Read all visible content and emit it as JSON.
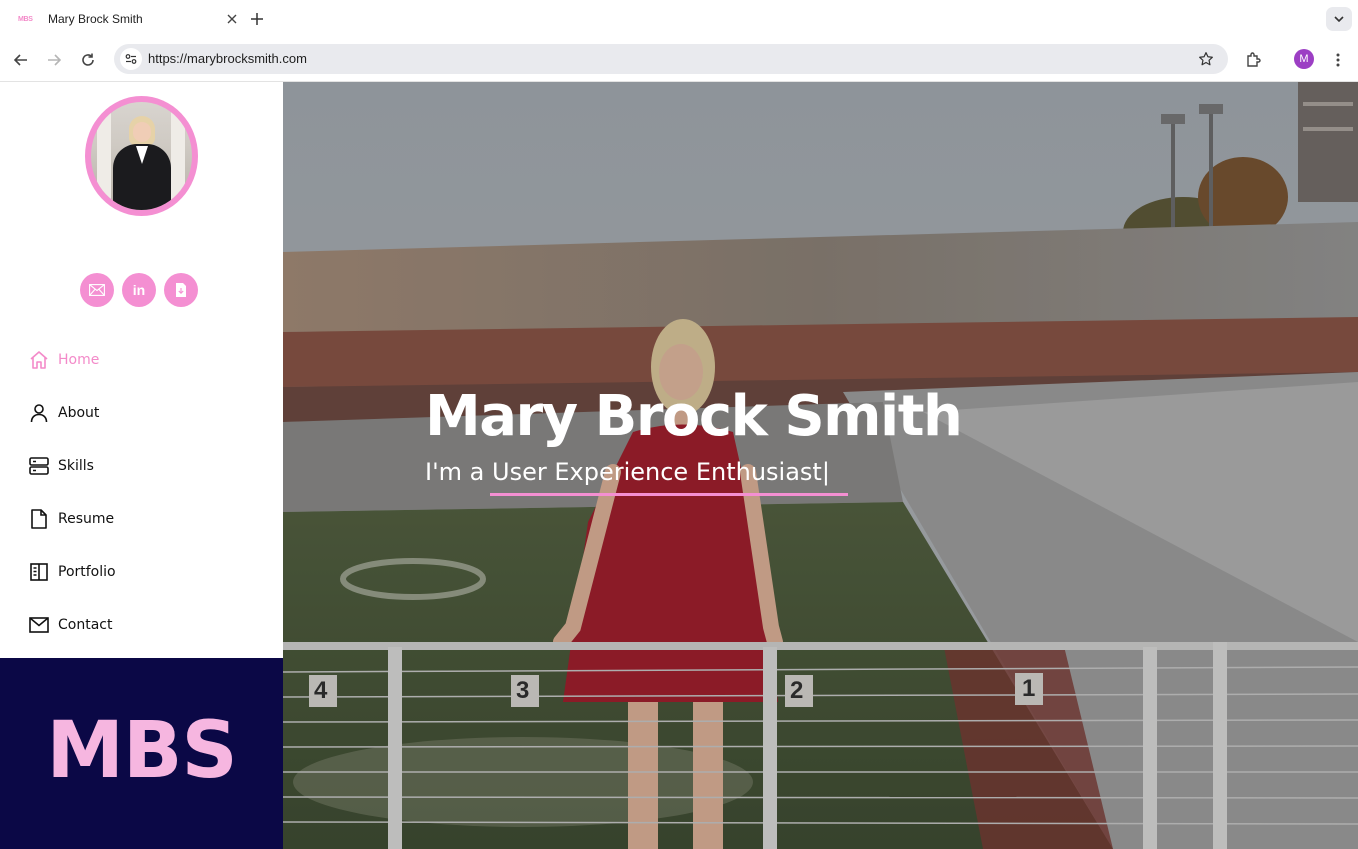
{
  "browser": {
    "tab_favicon_text": "MBS",
    "tab_title": "Mary Brock Smith",
    "url": "https://marybrocksmith.com",
    "profile_initial": "M"
  },
  "sidebar": {
    "socials": [
      {
        "icon": "envelope-icon"
      },
      {
        "icon": "linkedin-icon",
        "label": "in"
      },
      {
        "icon": "file-download-icon"
      }
    ],
    "nav": [
      {
        "label": "Home",
        "icon": "home-icon",
        "active": true
      },
      {
        "label": "About",
        "icon": "person-icon",
        "active": false
      },
      {
        "label": "Skills",
        "icon": "server-icon",
        "active": false
      },
      {
        "label": "Resume",
        "icon": "file-icon",
        "active": false
      },
      {
        "label": "Portfolio",
        "icon": "columns-icon",
        "active": false
      },
      {
        "label": "Contact",
        "icon": "envelope-icon",
        "active": false
      }
    ],
    "brand": "MBS"
  },
  "hero": {
    "name": "Mary Brock Smith",
    "tagline": "I'm a User Experience Enthusiast|",
    "railing_numbers": [
      "4",
      "3",
      "2",
      "1"
    ]
  },
  "colors": {
    "accent_pink": "#f48fd2",
    "brand_navy": "#0b0846",
    "brand_text": "#f6b6e0",
    "active_nav": "#f38ac9"
  }
}
